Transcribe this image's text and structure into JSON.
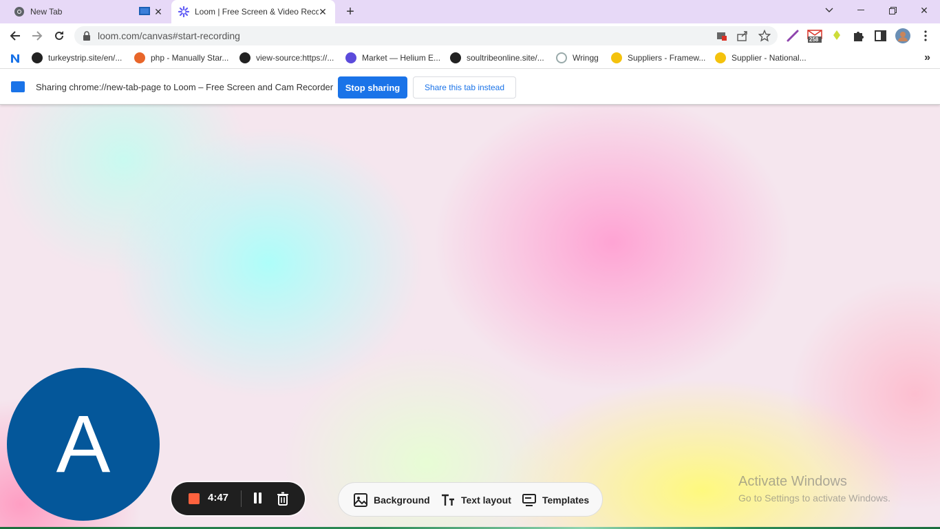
{
  "tabs": [
    {
      "title": "New Tab",
      "icon": "chrome-icon"
    },
    {
      "title": "Loom | Free Screen & Video Recc",
      "icon": "loom-icon",
      "active": true
    }
  ],
  "address_bar": {
    "url": "loom.com/canvas#start-recording"
  },
  "extensions": {
    "gmail_badge": "258"
  },
  "bookmarks": [
    {
      "label": "turkeystrip.site/en/...",
      "icon": "globe-icon"
    },
    {
      "label": "php - Manually Star...",
      "icon": "ask-icon"
    },
    {
      "label": "view-source:https://...",
      "icon": "globe-icon"
    },
    {
      "label": "Market — Helium E...",
      "icon": "helium-icon"
    },
    {
      "label": "soultribeonline.site/...",
      "icon": "globe-icon"
    },
    {
      "label": "Wringg",
      "icon": "wringg-icon"
    },
    {
      "label": "Suppliers - Framew...",
      "icon": "sun-icon"
    },
    {
      "label": "Supplier - National...",
      "icon": "sun-icon"
    }
  ],
  "share_bar": {
    "message": "Sharing chrome://new-tab-page to Loom – Free Screen and Cam Recorder",
    "stop_label": "Stop sharing",
    "share_tab_label": "Share this tab instead"
  },
  "canvas": {
    "avatar_letter": "A",
    "avatar_color": "#04579a",
    "recording": {
      "time": "4:47",
      "stop_color": "#ff623e"
    },
    "options": [
      {
        "label": "Background",
        "icon": "image-icon"
      },
      {
        "label": "Text layout",
        "icon": "text-icon"
      },
      {
        "label": "Templates",
        "icon": "monitor-icon"
      }
    ]
  },
  "watermark": {
    "title": "Activate Windows",
    "subtitle": "Go to Settings to activate Windows."
  }
}
